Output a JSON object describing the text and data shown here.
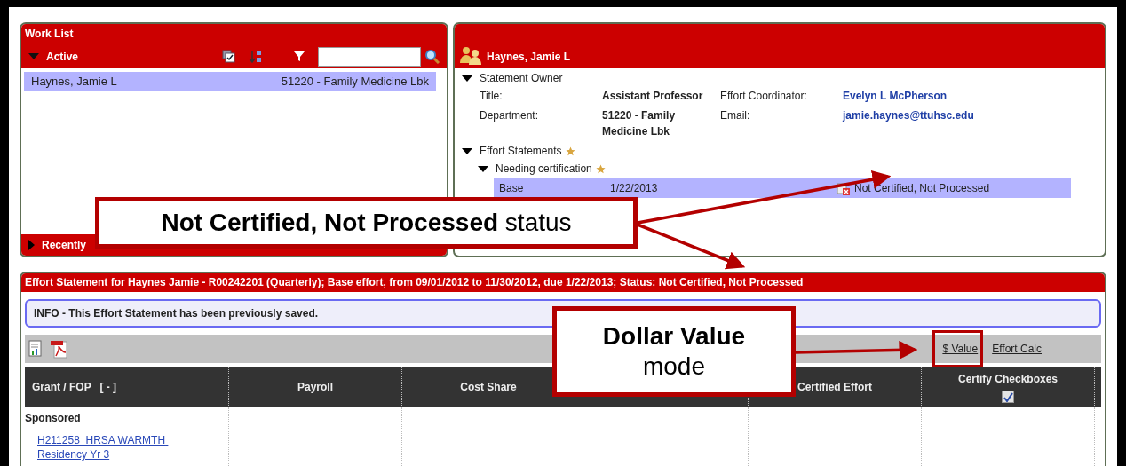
{
  "work_list": {
    "title": "Work List",
    "active": {
      "label": "Active",
      "expanded": true
    },
    "rows": [
      {
        "name": "Haynes, Jamie L",
        "department": "51220 - Family Medicine Lbk",
        "selected": true
      }
    ],
    "recent": {
      "label": "Recently",
      "expanded": false
    }
  },
  "statement_owner_panel": {
    "title": "Haynes, Jamie L",
    "owner": {
      "label": "Statement Owner",
      "expanded": true,
      "fields": [
        {
          "label": "Title:",
          "value": "Assistant Professor",
          "kind": "text"
        },
        {
          "label": "Effort Coordinator:",
          "value": "Evelyn L McPherson",
          "kind": "link"
        },
        {
          "label": "Department:",
          "value": "51220 - Family Medicine Lbk",
          "kind": "text"
        },
        {
          "label": "Email:",
          "value": "jamie.haynes@ttuhsc.edu",
          "kind": "link"
        }
      ]
    },
    "statements": {
      "label": "Effort Statements",
      "expanded": true,
      "starred": true,
      "groups": [
        {
          "label": "Needing certification",
          "expanded": true,
          "starred": true,
          "items": [
            {
              "type": "Base",
              "due": "1/22/2013",
              "status": "Not Certified, Not Processed",
              "selected": true
            }
          ]
        }
      ]
    }
  },
  "effort_statement": {
    "title": "Effort Statement for Haynes Jamie - R00242201 (Quarterly); Base effort, from 09/01/2012 to 11/30/2012, due 1/22/2013; Status: Not Certified, Not Processed",
    "info": "INFO - This Effort Statement has been previously saved.",
    "view_modes": [
      "$ Value",
      "Effort Calc"
    ],
    "columns": [
      {
        "label": "Grant / FOP   [ - ]",
        "kind": "text"
      },
      {
        "label": "Payroll",
        "kind": "text"
      },
      {
        "label": "Cost Share",
        "kind": "text"
      },
      {
        "kind": "hidden"
      },
      {
        "label": "Certified Effort",
        "kind": "text"
      },
      {
        "label": "Certify Checkboxes",
        "kind": "checkbox",
        "checked": true
      }
    ],
    "rows": [
      {
        "kind": "group",
        "label": "Sponsored"
      },
      {
        "kind": "link",
        "label": "H211258  HRSA WARMTH Residency Yr 3"
      }
    ]
  },
  "callouts": [
    {
      "text": "**Not Certified, Not Processed** status"
    },
    {
      "title": "Dollar Value",
      "text": "mode"
    }
  ]
}
